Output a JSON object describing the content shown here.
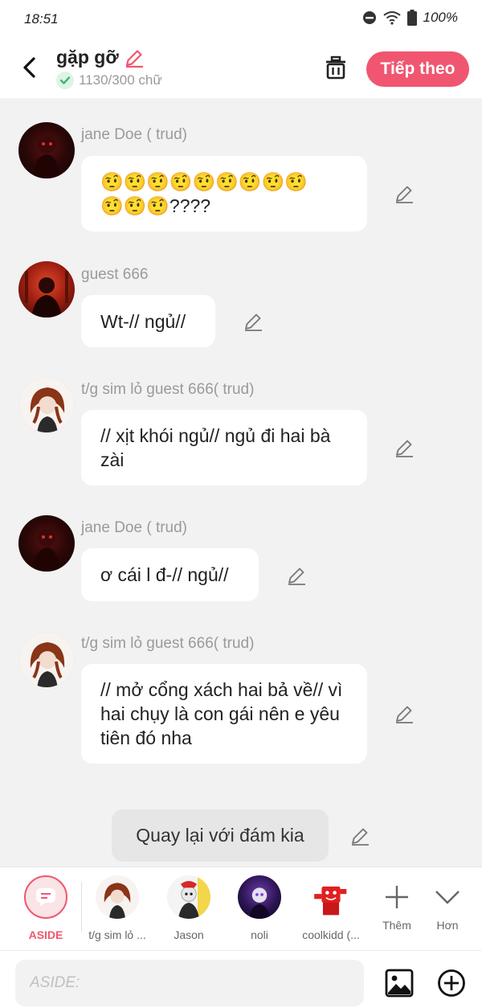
{
  "status": {
    "time": "18:51",
    "battery": "100%"
  },
  "header": {
    "title": "gặp gỡ",
    "word_count": "1130/300 chữ",
    "next_label": "Tiếp theo",
    "accent": "#f0566f"
  },
  "messages": [
    {
      "sender": "jane Doe ( trud)",
      "text": "🤨🤨🤨🤨🤨🤨🤨🤨🤨\n🤨🤨🤨????"
    },
    {
      "sender": "guest 666",
      "text": "Wt-// ngủ//"
    },
    {
      "sender": "t/g sim lỏ guest 666( trud)",
      "text": "// xịt khói ngủ// ngủ đi hai bà zài"
    },
    {
      "sender": "jane Doe ( trud)",
      "text": "ơ cái l đ-// ngủ//"
    },
    {
      "sender": "t/g sim lỏ guest 666( trud)",
      "text": "// mở cổng xách hai bả về// vì hai chụy là con gái nên e yêu tiên đó nha"
    }
  ],
  "aside_message": "Quay lại với đám kia",
  "characters": [
    {
      "label": "ASIDE"
    },
    {
      "label": "t/g sim lỏ ..."
    },
    {
      "label": "Jason"
    },
    {
      "label": "noli"
    },
    {
      "label": "coolkidd (..."
    }
  ],
  "more": {
    "add_label": "Thêm",
    "more_label": "Hơn"
  },
  "input": {
    "placeholder": "ASIDE:"
  }
}
